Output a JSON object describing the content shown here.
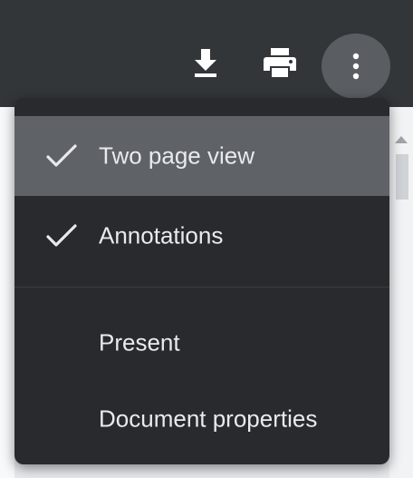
{
  "toolbar": {
    "buttons": [
      {
        "name": "download",
        "icon": "download-icon"
      },
      {
        "name": "print",
        "icon": "print-icon"
      },
      {
        "name": "more",
        "icon": "more-vertical-icon",
        "active": true
      }
    ]
  },
  "menu": {
    "items": [
      {
        "label": "Two page view",
        "checked": true,
        "highlighted": true
      },
      {
        "label": "Annotations",
        "checked": true,
        "highlighted": false
      },
      {
        "label": "Present",
        "checked": false,
        "highlighted": false
      },
      {
        "label": "Document properties",
        "checked": false,
        "highlighted": false
      }
    ]
  },
  "colors": {
    "toolbar_bg": "#323639",
    "menu_bg": "#292a2d",
    "highlight_bg": "#5f6368",
    "text": "#e8eaed",
    "icon": "#ffffff"
  }
}
